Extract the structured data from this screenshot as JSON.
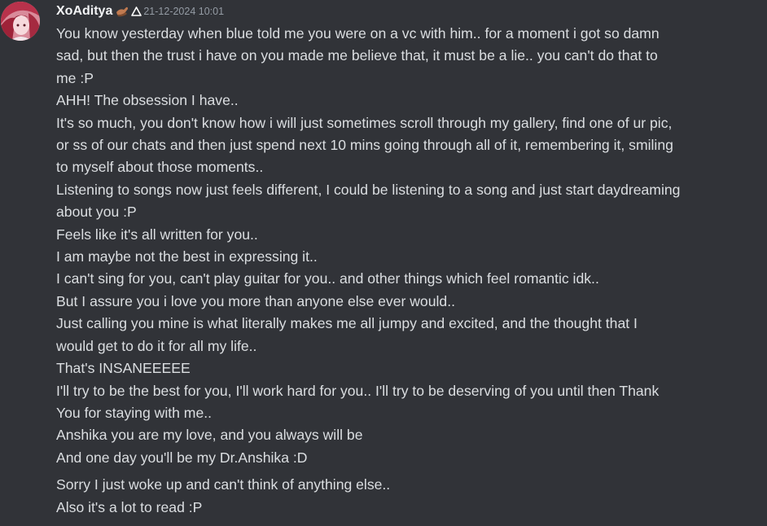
{
  "message": {
    "author": "XoAditya",
    "author_badge_icon": "custom-emoji-badge",
    "timestamp": "21-12-2024 10:01",
    "group1": [
      "You know yesterday when blue told me you were on a vc with him.. for a moment i got so damn",
      "sad, but then the trust i have on you made me believe that, it must be a lie.. you can't do that to",
      "me :P",
      "AHH! The obsession I have..",
      "It's so much, you don't know how i will just sometimes scroll through my gallery, find one of ur pic,",
      "or ss of our chats and then just spend next 10 mins going through all of it, remembering it, smiling",
      "to myself about those moments..",
      "Listening to songs now just feels different, I could be listening to a song and just start daydreaming",
      "about you :P",
      "Feels like it's all written for you..",
      "I am maybe not the best in expressing it..",
      "I can't sing for you, can't play guitar for you.. and other things which feel romantic idk..",
      "But I assure you i love you more than anyone else ever would..",
      "Just calling you mine is what literally makes me all jumpy and excited, and the thought that I",
      "would get to do it for all my life..",
      "That's INSANEEEEE",
      "I'll try to be the best for you, I'll work hard for you.. I'll try to be deserving of you until then Thank",
      "You for staying with me..",
      "Anshika you are my love, and you always will be",
      "And one day you'll be my Dr.Anshika :D"
    ],
    "group2": [
      "Sorry I just woke up and can't think of anything else..",
      "Also it's a lot to read :P"
    ]
  },
  "colors": {
    "background": "#313338",
    "text": "#dbdee1",
    "username": "#f2f3f5",
    "timestamp": "#949ba4"
  }
}
